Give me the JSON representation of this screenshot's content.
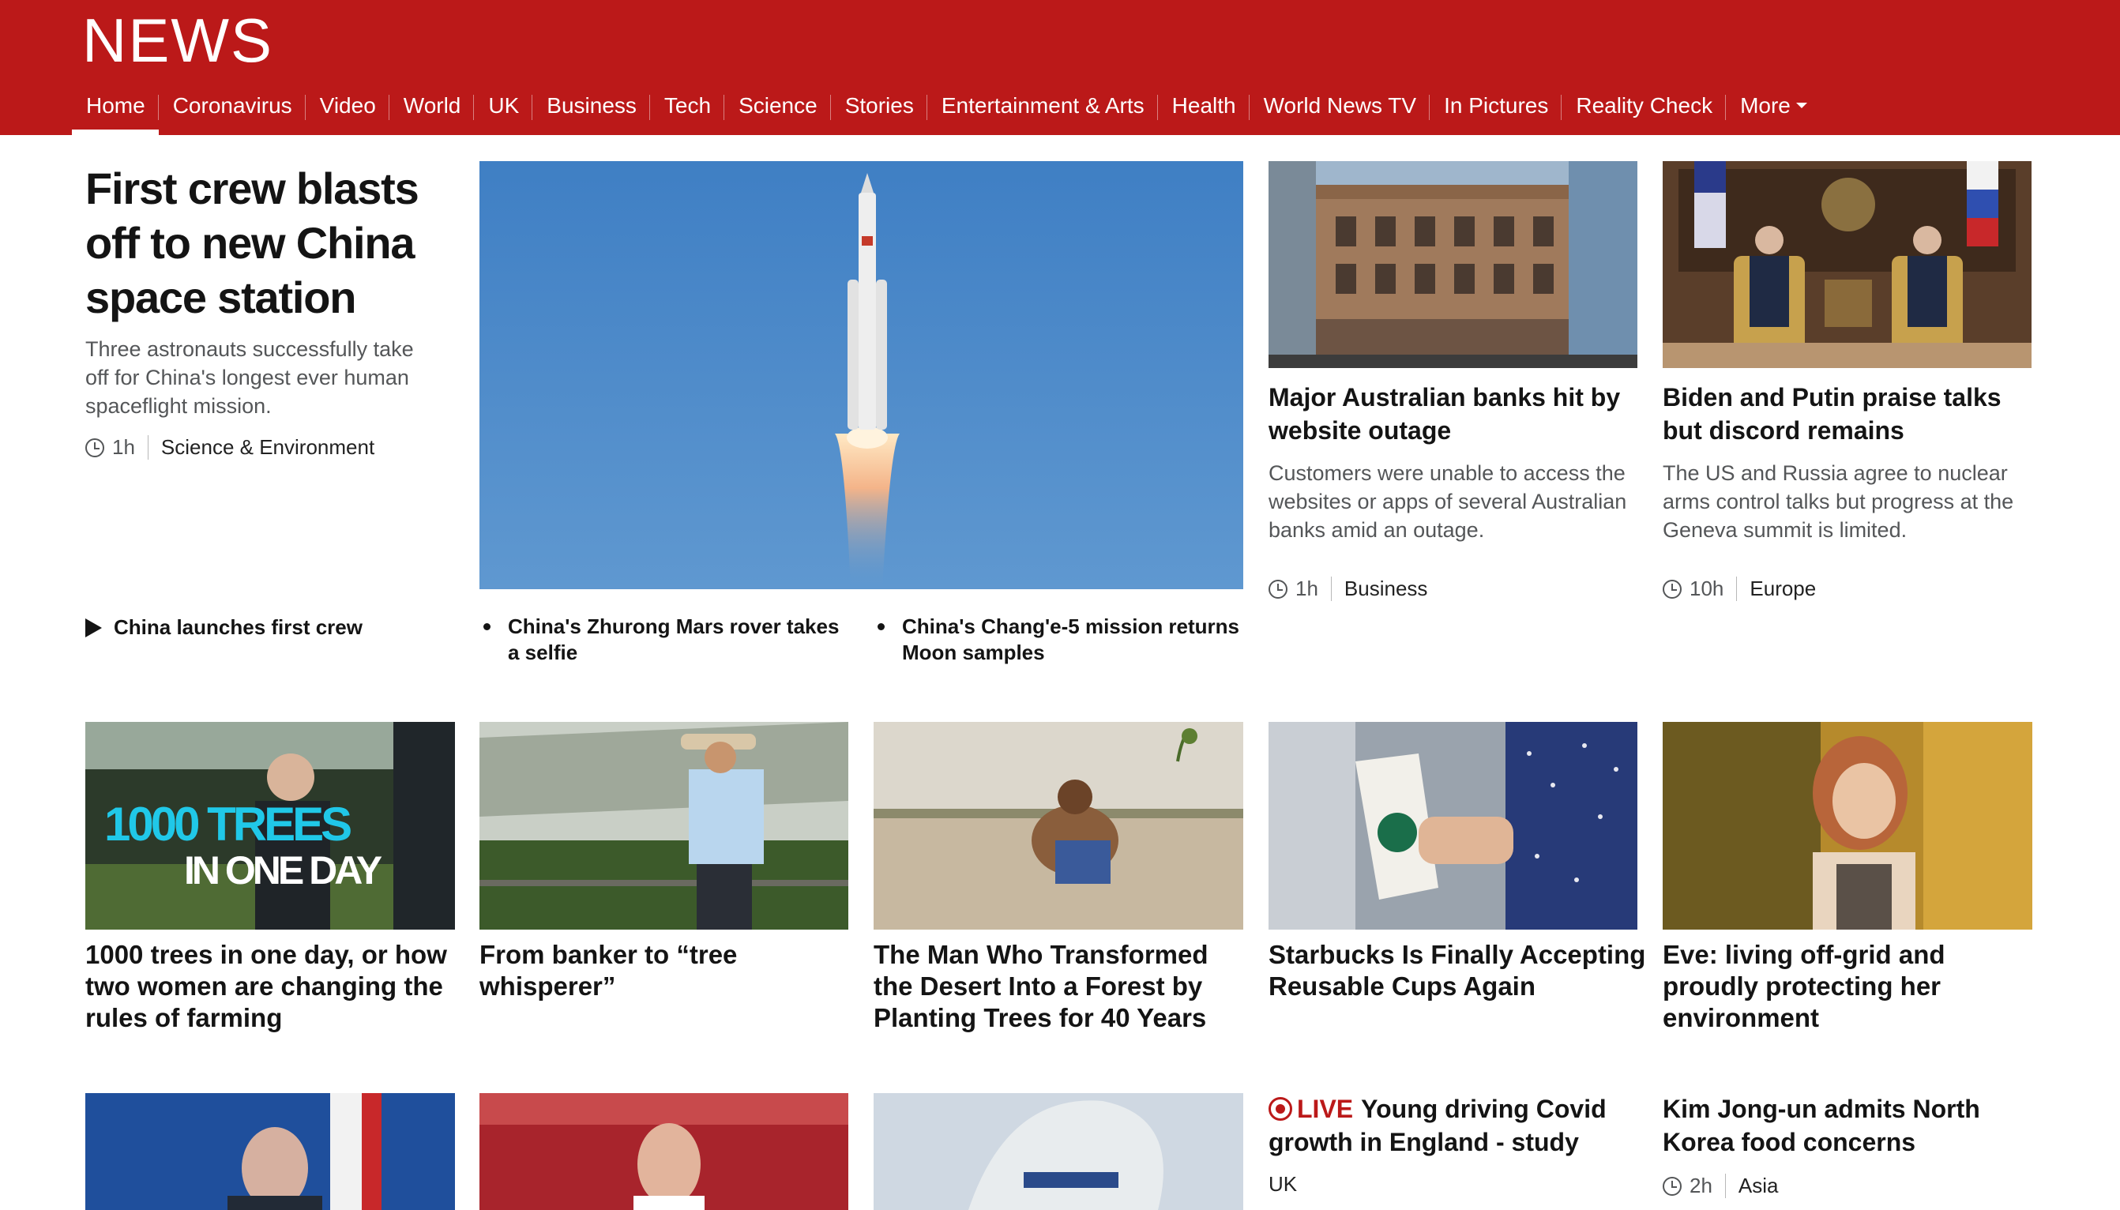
{
  "header": {
    "logo": "NEWS",
    "nav": [
      "Home",
      "Coronavirus",
      "Video",
      "World",
      "UK",
      "Business",
      "Tech",
      "Science",
      "Stories",
      "Entertainment & Arts",
      "Health",
      "World News TV",
      "In Pictures",
      "Reality Check"
    ],
    "more_label": "More"
  },
  "lead": {
    "title": "First crew blasts off to new China space station",
    "summary": "Three astronauts successfully take off for China's longest ever human spaceflight mission.",
    "time": "1h",
    "section": "Science & Environment",
    "video_link": "China launches first crew"
  },
  "related": [
    "China's Zhurong Mars rover takes a selfie",
    "China's Chang'e-5 mission returns Moon samples"
  ],
  "top_stories": [
    {
      "headline": "Major Australian banks hit by website outage",
      "summary": "Customers were unable to access the websites or apps of several Australian banks amid an outage.",
      "time": "1h",
      "section": "Business"
    },
    {
      "headline": "Biden and Putin praise talks but discord remains",
      "summary": "The US and Russia agree to nuclear arms control talks but progress at the Geneva summit is limited.",
      "time": "10h",
      "section": "Europe"
    }
  ],
  "features": [
    {
      "headline": "1000 trees in one day, or how two women are changing the rules of farming",
      "image_overlay_1": "1000 TREES",
      "image_overlay_2": "IN ONE DAY"
    },
    {
      "headline": "From banker to “tree whisperer”"
    },
    {
      "headline": "The Man Who Transformed the Desert Into a Forest by Planting Trees for 40 Years"
    },
    {
      "headline": "Starbucks Is Finally Accepting Reusable Cups Again"
    },
    {
      "headline": "Eve: living off-grid and proudly protecting her environment"
    }
  ],
  "bottom": {
    "live_label": "LIVE",
    "live_headline": "Young driving Covid growth in England - study",
    "live_section": "UK",
    "story_headline": "Kim Jong-un admits North Korea food concerns",
    "story_time": "2h",
    "story_section": "Asia"
  },
  "colors": {
    "brand_red": "#bb1919",
    "text": "#141414",
    "summary_grey": "#545658"
  }
}
